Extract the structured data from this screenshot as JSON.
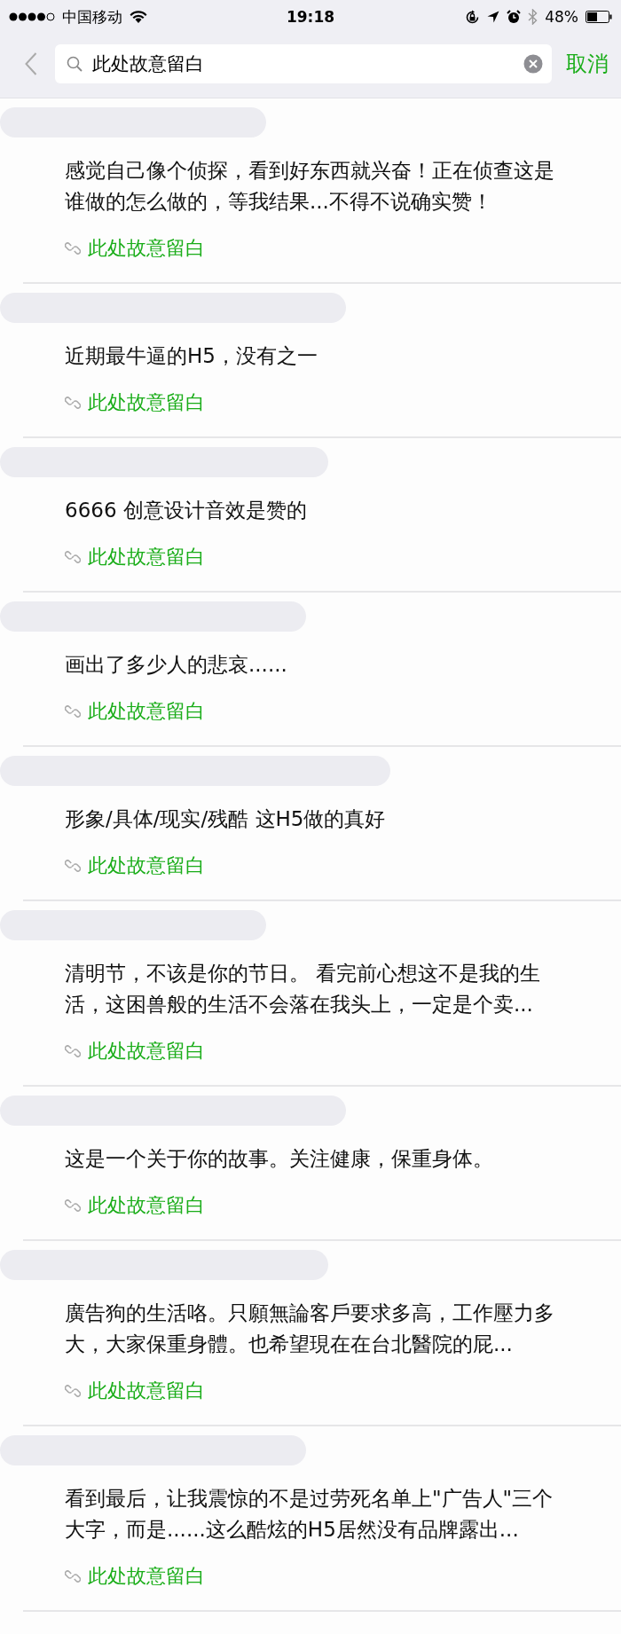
{
  "status_bar": {
    "carrier": "中国移动",
    "time": "19:18",
    "battery": "48%"
  },
  "nav": {
    "search": {
      "value": "此处故意留白"
    },
    "cancel": "取消"
  },
  "results": [
    {
      "text": "感觉自己像个侦探，看到好东西就兴奋！正在侦查这是谁做的怎么做的，等我结果...不得不说确实赞！",
      "link": "此处故意留白"
    },
    {
      "text": "近期最牛逼的H5，没有之一",
      "link": "此处故意留白"
    },
    {
      "text": "6666 创意设计音效是赞的",
      "link": "此处故意留白"
    },
    {
      "text": "画出了多少人的悲哀......",
      "link": "此处故意留白"
    },
    {
      "text": "形象/具体/现实/残酷 这H5做的真好",
      "link": "此处故意留白"
    },
    {
      "text": "清明节，不该是你的节日。 看完前心想这不是我的生活，这困兽般的生活不会落在我头上，一定是个卖...",
      "link": "此处故意留白"
    },
    {
      "text": "这是一个关于你的故事。关注健康，保重身体。",
      "link": "此处故意留白"
    },
    {
      "text": "廣告狗的生活咯。只願無論客戶要求多高，工作壓力多大，大家保重身體。也希望現在在台北醫院的屁...",
      "link": "此处故意留白"
    },
    {
      "text": "看到最后，让我震惊的不是过劳死名单上\"广告人\"三个大字，而是......这么酷炫的H5居然没有品牌露出...",
      "link": "此处故意留白"
    }
  ]
}
